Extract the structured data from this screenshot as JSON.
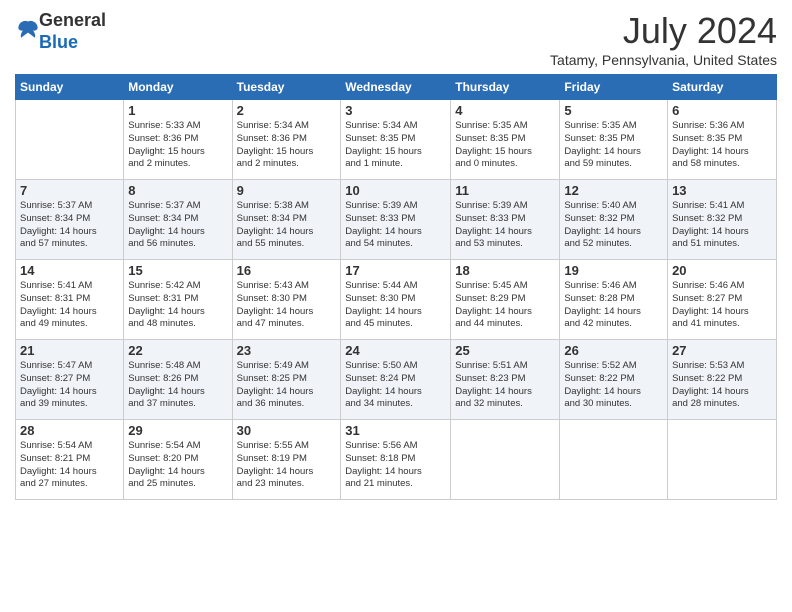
{
  "logo": {
    "general": "General",
    "blue": "Blue"
  },
  "title": "July 2024",
  "location": "Tatamy, Pennsylvania, United States",
  "days_of_week": [
    "Sunday",
    "Monday",
    "Tuesday",
    "Wednesday",
    "Thursday",
    "Friday",
    "Saturday"
  ],
  "weeks": [
    [
      {
        "day": "",
        "info": ""
      },
      {
        "day": "1",
        "info": "Sunrise: 5:33 AM\nSunset: 8:36 PM\nDaylight: 15 hours\nand 2 minutes."
      },
      {
        "day": "2",
        "info": "Sunrise: 5:34 AM\nSunset: 8:36 PM\nDaylight: 15 hours\nand 2 minutes."
      },
      {
        "day": "3",
        "info": "Sunrise: 5:34 AM\nSunset: 8:35 PM\nDaylight: 15 hours\nand 1 minute."
      },
      {
        "day": "4",
        "info": "Sunrise: 5:35 AM\nSunset: 8:35 PM\nDaylight: 15 hours\nand 0 minutes."
      },
      {
        "day": "5",
        "info": "Sunrise: 5:35 AM\nSunset: 8:35 PM\nDaylight: 14 hours\nand 59 minutes."
      },
      {
        "day": "6",
        "info": "Sunrise: 5:36 AM\nSunset: 8:35 PM\nDaylight: 14 hours\nand 58 minutes."
      }
    ],
    [
      {
        "day": "7",
        "info": "Sunrise: 5:37 AM\nSunset: 8:34 PM\nDaylight: 14 hours\nand 57 minutes."
      },
      {
        "day": "8",
        "info": "Sunrise: 5:37 AM\nSunset: 8:34 PM\nDaylight: 14 hours\nand 56 minutes."
      },
      {
        "day": "9",
        "info": "Sunrise: 5:38 AM\nSunset: 8:34 PM\nDaylight: 14 hours\nand 55 minutes."
      },
      {
        "day": "10",
        "info": "Sunrise: 5:39 AM\nSunset: 8:33 PM\nDaylight: 14 hours\nand 54 minutes."
      },
      {
        "day": "11",
        "info": "Sunrise: 5:39 AM\nSunset: 8:33 PM\nDaylight: 14 hours\nand 53 minutes."
      },
      {
        "day": "12",
        "info": "Sunrise: 5:40 AM\nSunset: 8:32 PM\nDaylight: 14 hours\nand 52 minutes."
      },
      {
        "day": "13",
        "info": "Sunrise: 5:41 AM\nSunset: 8:32 PM\nDaylight: 14 hours\nand 51 minutes."
      }
    ],
    [
      {
        "day": "14",
        "info": "Sunrise: 5:41 AM\nSunset: 8:31 PM\nDaylight: 14 hours\nand 49 minutes."
      },
      {
        "day": "15",
        "info": "Sunrise: 5:42 AM\nSunset: 8:31 PM\nDaylight: 14 hours\nand 48 minutes."
      },
      {
        "day": "16",
        "info": "Sunrise: 5:43 AM\nSunset: 8:30 PM\nDaylight: 14 hours\nand 47 minutes."
      },
      {
        "day": "17",
        "info": "Sunrise: 5:44 AM\nSunset: 8:30 PM\nDaylight: 14 hours\nand 45 minutes."
      },
      {
        "day": "18",
        "info": "Sunrise: 5:45 AM\nSunset: 8:29 PM\nDaylight: 14 hours\nand 44 minutes."
      },
      {
        "day": "19",
        "info": "Sunrise: 5:46 AM\nSunset: 8:28 PM\nDaylight: 14 hours\nand 42 minutes."
      },
      {
        "day": "20",
        "info": "Sunrise: 5:46 AM\nSunset: 8:27 PM\nDaylight: 14 hours\nand 41 minutes."
      }
    ],
    [
      {
        "day": "21",
        "info": "Sunrise: 5:47 AM\nSunset: 8:27 PM\nDaylight: 14 hours\nand 39 minutes."
      },
      {
        "day": "22",
        "info": "Sunrise: 5:48 AM\nSunset: 8:26 PM\nDaylight: 14 hours\nand 37 minutes."
      },
      {
        "day": "23",
        "info": "Sunrise: 5:49 AM\nSunset: 8:25 PM\nDaylight: 14 hours\nand 36 minutes."
      },
      {
        "day": "24",
        "info": "Sunrise: 5:50 AM\nSunset: 8:24 PM\nDaylight: 14 hours\nand 34 minutes."
      },
      {
        "day": "25",
        "info": "Sunrise: 5:51 AM\nSunset: 8:23 PM\nDaylight: 14 hours\nand 32 minutes."
      },
      {
        "day": "26",
        "info": "Sunrise: 5:52 AM\nSunset: 8:22 PM\nDaylight: 14 hours\nand 30 minutes."
      },
      {
        "day": "27",
        "info": "Sunrise: 5:53 AM\nSunset: 8:22 PM\nDaylight: 14 hours\nand 28 minutes."
      }
    ],
    [
      {
        "day": "28",
        "info": "Sunrise: 5:54 AM\nSunset: 8:21 PM\nDaylight: 14 hours\nand 27 minutes."
      },
      {
        "day": "29",
        "info": "Sunrise: 5:54 AM\nSunset: 8:20 PM\nDaylight: 14 hours\nand 25 minutes."
      },
      {
        "day": "30",
        "info": "Sunrise: 5:55 AM\nSunset: 8:19 PM\nDaylight: 14 hours\nand 23 minutes."
      },
      {
        "day": "31",
        "info": "Sunrise: 5:56 AM\nSunset: 8:18 PM\nDaylight: 14 hours\nand 21 minutes."
      },
      {
        "day": "",
        "info": ""
      },
      {
        "day": "",
        "info": ""
      },
      {
        "day": "",
        "info": ""
      }
    ]
  ]
}
